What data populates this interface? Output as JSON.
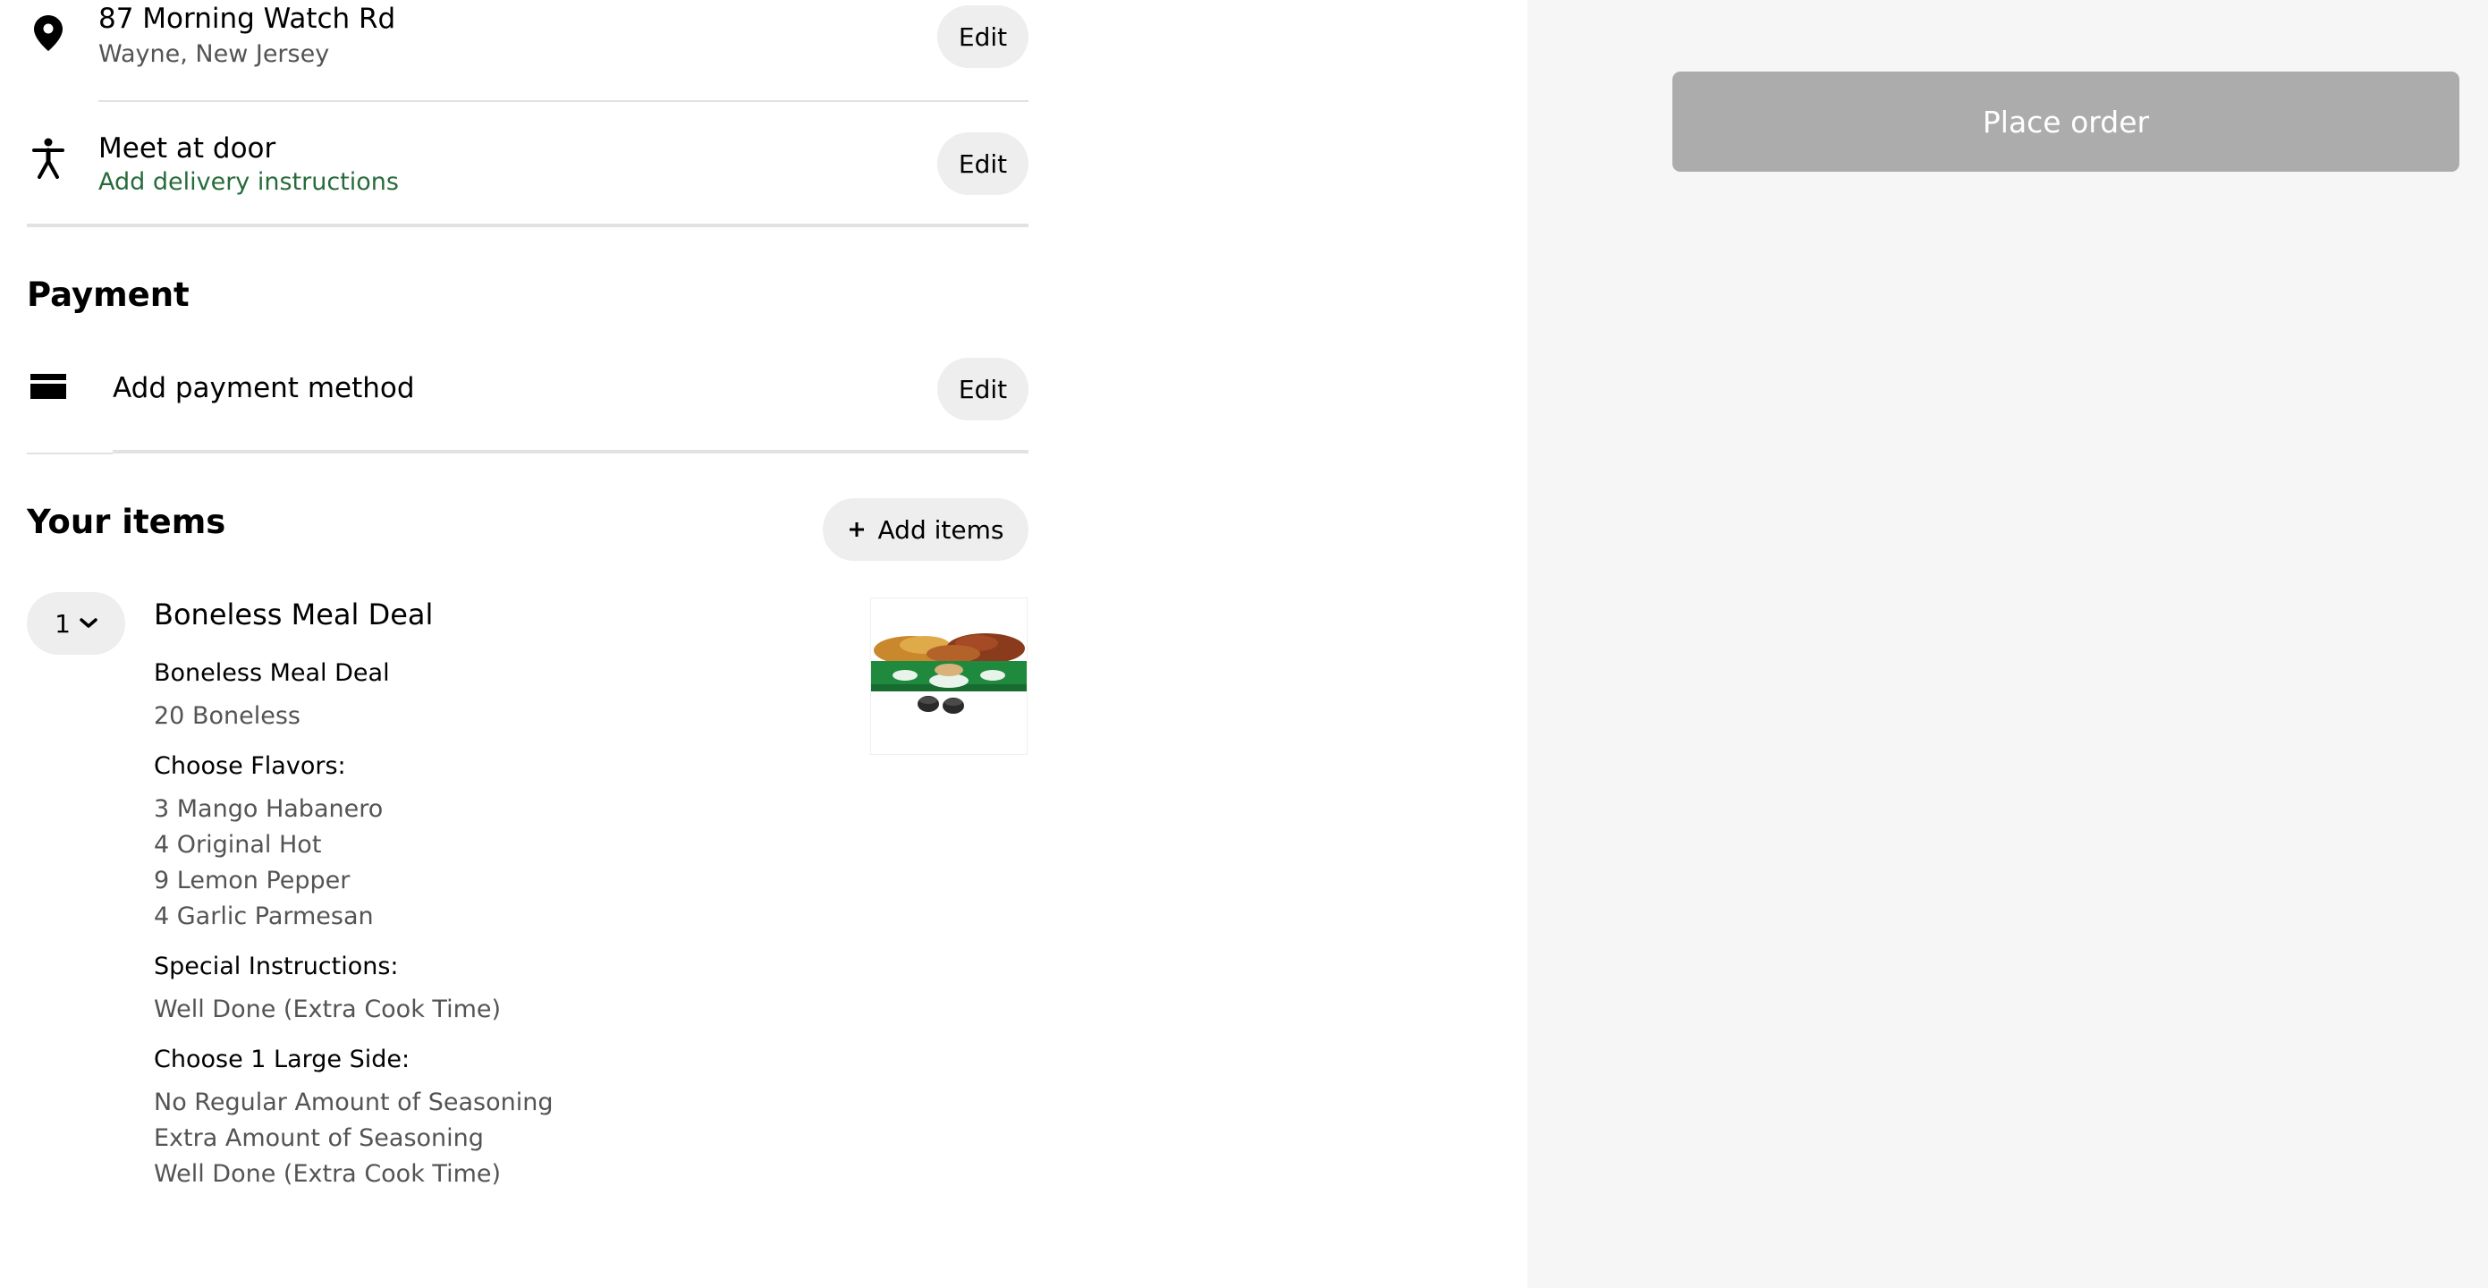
{
  "delivery": {
    "address_line1": "87 Morning Watch Rd",
    "address_line2": "Wayne, New Jersey",
    "dropoff_option": "Meet at door",
    "instructions_link": "Add delivery instructions",
    "edit_label": "Edit"
  },
  "payment": {
    "title": "Payment",
    "method_label": "Add payment method",
    "edit_label": "Edit"
  },
  "items": {
    "title": "Your items",
    "add_items_label": "Add items",
    "list": [
      {
        "quantity": "1",
        "name": "Boneless Meal Deal",
        "details": {
          "combo_name": "Boneless Meal Deal",
          "size": "20 Boneless",
          "flavors_label": "Choose Flavors:",
          "flavors": [
            "3 Mango Habanero",
            "4 Original Hot",
            "9 Lemon Pepper",
            "4 Garlic Parmesan"
          ],
          "special_label": "Special Instructions:",
          "special": [
            "Well Done (Extra Cook Time)"
          ],
          "side_label": "Choose 1 Large Side:",
          "sides": [
            "No Regular Amount of Seasoning",
            "Extra Amount of Seasoning",
            "Well Done (Extra Cook Time)"
          ]
        }
      }
    ]
  },
  "summary": {
    "place_order_label": "Place order"
  },
  "colors": {
    "accent_green": "#276b3b",
    "button_disabled": "#acacac",
    "pill_bg": "#eeeeee",
    "side_panel_bg": "#f6f6f6"
  }
}
